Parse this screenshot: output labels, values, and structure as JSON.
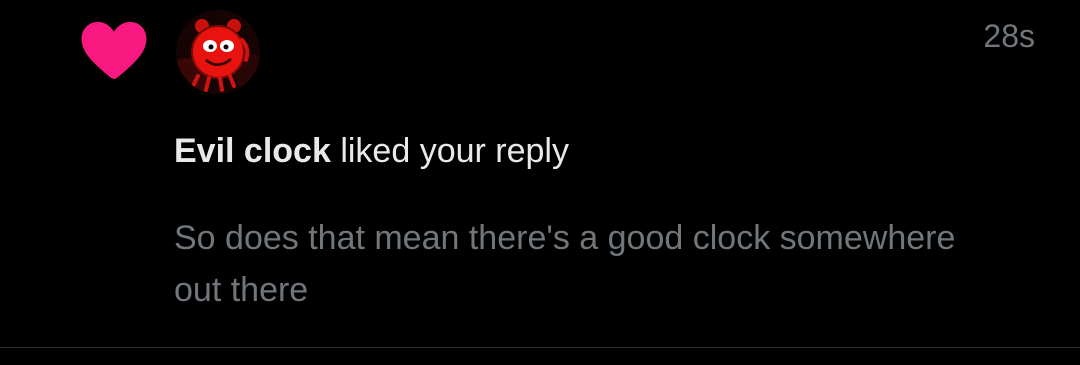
{
  "notification": {
    "type_icon": "heart-icon",
    "actor_name": "Evil clock",
    "action_text": "liked your reply",
    "timestamp": "28s",
    "reply_text": "So does that mean there's a good clock somewhere out there"
  },
  "colors": {
    "background": "#000000",
    "heart": "#f91880",
    "primary_text": "#e7e9ea",
    "secondary_text": "#71767b",
    "divider": "#2f3336",
    "avatar_red": "#e8120f"
  }
}
